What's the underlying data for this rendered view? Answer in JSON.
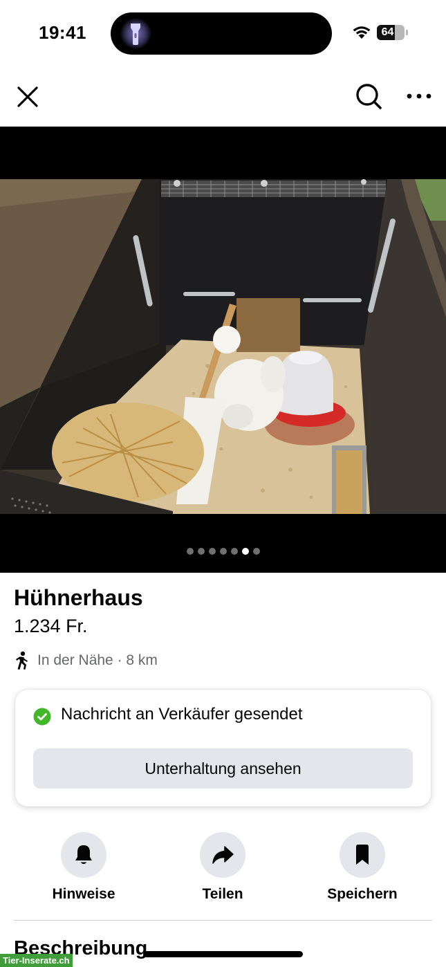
{
  "status_bar": {
    "time": "19:41",
    "battery_level": "64",
    "battery_fraction": 0.64
  },
  "nav": {
    "close_icon": "close-icon",
    "search_icon": "search-icon",
    "more_icon": "more-horizontal-icon"
  },
  "gallery": {
    "image_count": 7,
    "active_index": 5
  },
  "listing": {
    "title": "Hühnerhaus",
    "price": "1.234 Fr.",
    "location": "In der Nähe · 8 km",
    "location_icon": "walking-person-icon"
  },
  "message_card": {
    "status_text": "Nachricht an Verkäufer gesendet",
    "status_icon": "check-circle-icon",
    "status_color": "#42b72a",
    "button_label": "Unterhaltung ansehen"
  },
  "actions": [
    {
      "label": "Hinweise",
      "icon": "bell-icon"
    },
    {
      "label": "Teilen",
      "icon": "share-arrow-icon"
    },
    {
      "label": "Speichern",
      "icon": "bookmark-icon"
    }
  ],
  "description": {
    "heading": "Beschreibung"
  },
  "watermark": "Tier-Inserate.ch"
}
